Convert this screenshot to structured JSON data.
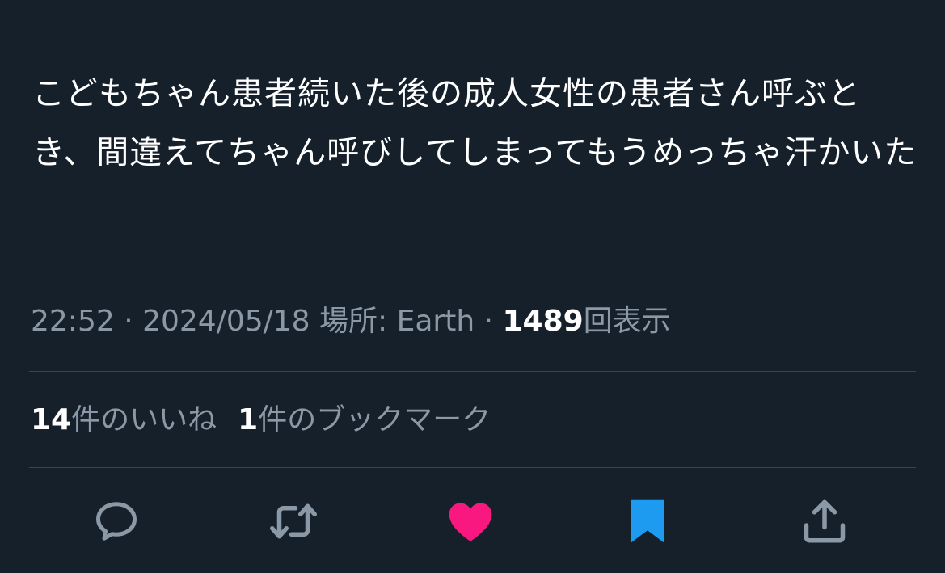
{
  "tweet": {
    "text": "こどもちゃん患者続いた後の成人女性の患者さん呼ぶとき、間違えてちゃん呼びしてしまってもうめっちゃ汗かいた"
  },
  "meta": {
    "time": "22:52",
    "sep1": " · ",
    "date": "2024/05/18",
    "location_label": " 場所: Earth",
    "sep2": " · ",
    "views_count": "1489",
    "views_label": "回表示"
  },
  "stats": {
    "likes_count": "14",
    "likes_label": "件のいいね",
    "bookmarks_count": "1",
    "bookmarks_label": "件のブックマーク"
  },
  "actions": [
    {
      "name": "reply-icon",
      "color": "#8b98a5"
    },
    {
      "name": "retweet-icon",
      "color": "#8b98a5"
    },
    {
      "name": "heart-icon",
      "color": "#f91880",
      "active": true
    },
    {
      "name": "bookmark-icon",
      "color": "#1d9bf0",
      "active": true
    },
    {
      "name": "share-icon",
      "color": "#8b98a5"
    }
  ],
  "colors": {
    "background": "#15202b",
    "secondary_text": "#8b98a5",
    "divider": "#38444d",
    "like": "#f91880",
    "bookmark": "#1d9bf0"
  }
}
